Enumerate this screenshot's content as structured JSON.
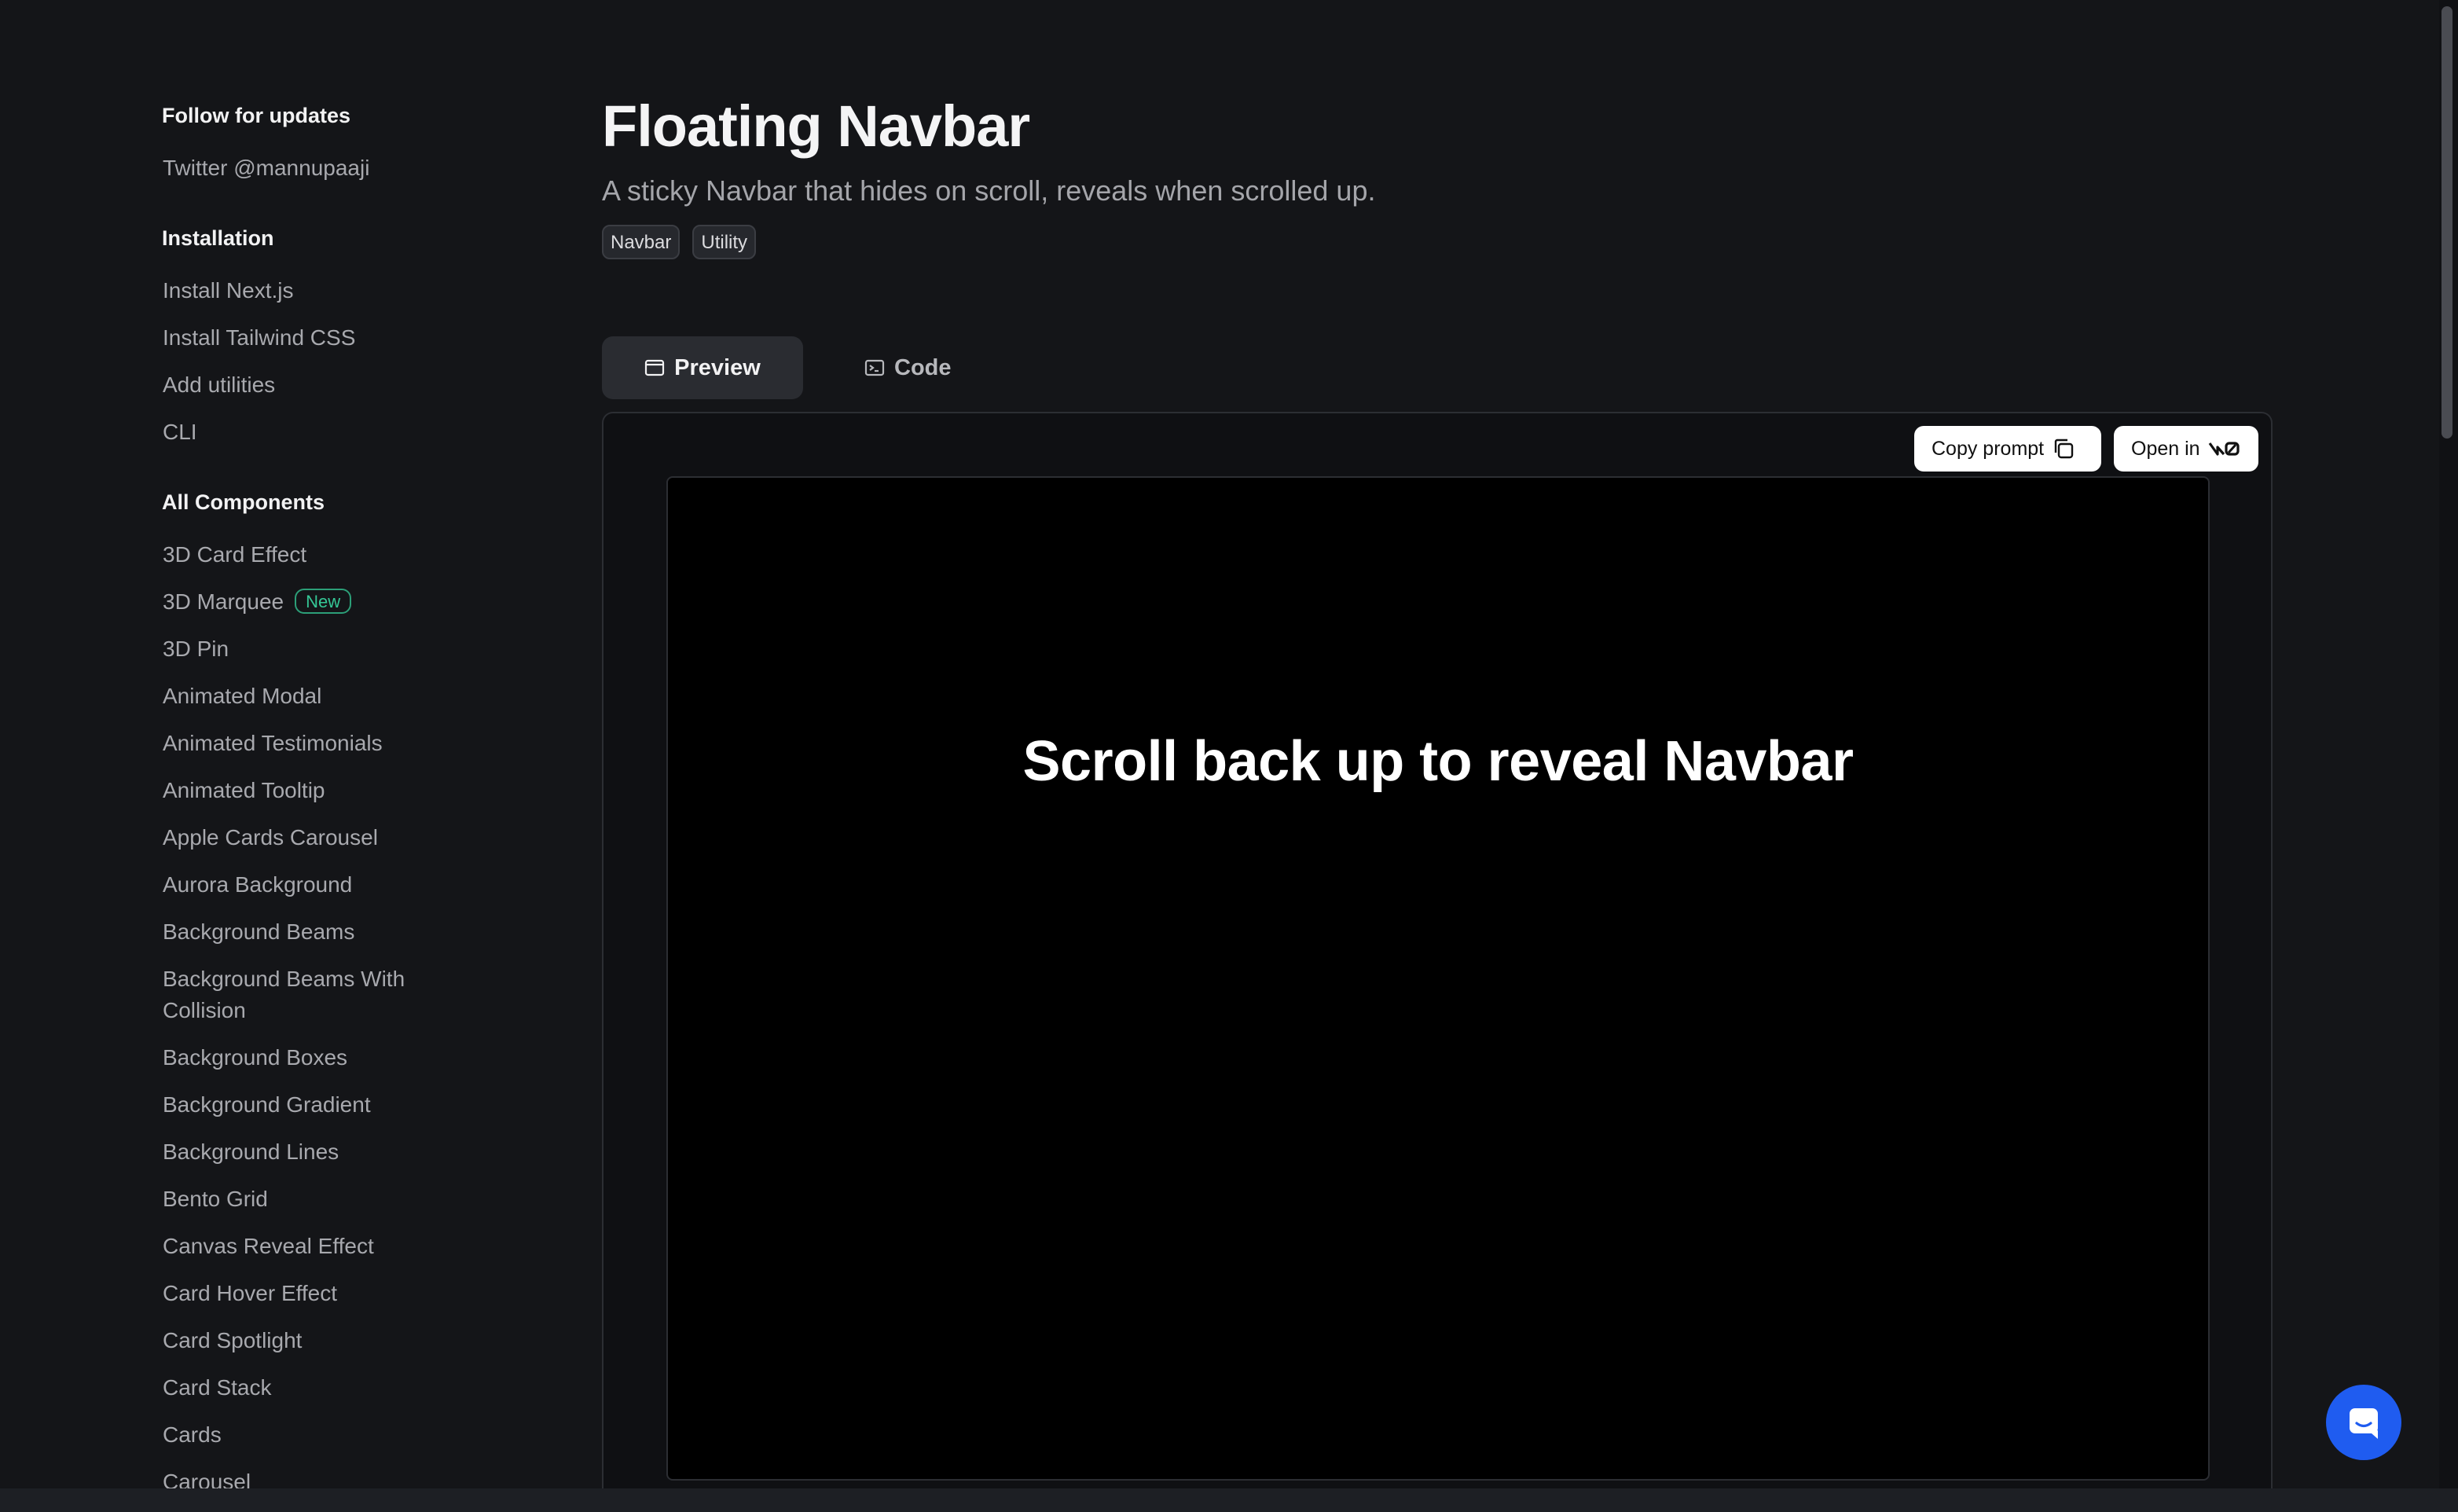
{
  "sidebar": {
    "follow": {
      "title": "Follow for updates",
      "twitter": "Twitter @mannupaaji"
    },
    "installation": {
      "title": "Installation",
      "items": [
        "Install Next.js",
        "Install Tailwind CSS",
        "Add utilities",
        "CLI"
      ]
    },
    "components": {
      "title": "All Components",
      "items": [
        "3D Card Effect",
        "3D Marquee",
        "3D Pin",
        "Animated Modal",
        "Animated Testimonials",
        "Animated Tooltip",
        "Apple Cards Carousel",
        "Aurora Background",
        "Background Beams",
        "Background Beams With Collision",
        "Background Boxes",
        "Background Gradient",
        "Background Lines",
        "Bento Grid",
        "Canvas Reveal Effect",
        "Card Hover Effect",
        "Card Spotlight",
        "Card Stack",
        "Cards",
        "Carousel"
      ],
      "new_badge": "New"
    }
  },
  "main": {
    "title": "Floating Navbar",
    "subtitle": "A sticky Navbar that hides on scroll, reveals when scrolled up.",
    "tags": [
      "Navbar",
      "Utility"
    ],
    "tabs": {
      "preview": "Preview",
      "code": "Code"
    },
    "actions": {
      "copy_prompt": "Copy prompt",
      "open_in": "Open in"
    },
    "demo_text": "Scroll back up to reveal Navbar"
  },
  "icons": {
    "preview_tab": "window-icon",
    "code_tab": "terminal-icon",
    "copy": "copy-icon",
    "v0": "v0-logo-icon",
    "chat": "chat-icon"
  },
  "colors": {
    "accent_blue": "#1f5cf0",
    "new_badge": "#35c796"
  }
}
